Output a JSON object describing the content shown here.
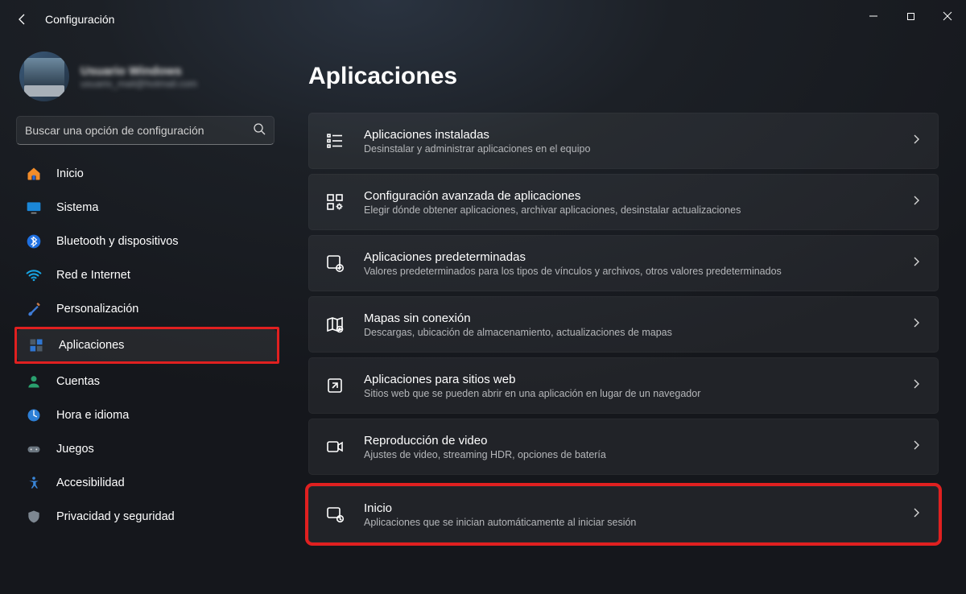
{
  "titlebar": {
    "title": "Configuración"
  },
  "user": {
    "name": "Usuario Windows",
    "email": "usuario_mail@hotmail.com"
  },
  "search": {
    "placeholder": "Buscar una opción de configuración"
  },
  "sidebar": {
    "items": [
      {
        "label": "Inicio"
      },
      {
        "label": "Sistema"
      },
      {
        "label": "Bluetooth y dispositivos"
      },
      {
        "label": "Red e Internet"
      },
      {
        "label": "Personalización"
      },
      {
        "label": "Aplicaciones"
      },
      {
        "label": "Cuentas"
      },
      {
        "label": "Hora e idioma"
      },
      {
        "label": "Juegos"
      },
      {
        "label": "Accesibilidad"
      },
      {
        "label": "Privacidad y seguridad"
      }
    ]
  },
  "page": {
    "heading": "Aplicaciones"
  },
  "cards": [
    {
      "title": "Aplicaciones instaladas",
      "subtitle": "Desinstalar y administrar aplicaciones en el equipo"
    },
    {
      "title": "Configuración avanzada de aplicaciones",
      "subtitle": "Elegir dónde obtener aplicaciones, archivar aplicaciones, desinstalar actualizaciones"
    },
    {
      "title": "Aplicaciones predeterminadas",
      "subtitle": "Valores predeterminados para los tipos de vínculos y archivos, otros valores predeterminados"
    },
    {
      "title": "Mapas sin conexión",
      "subtitle": "Descargas, ubicación de almacenamiento, actualizaciones de mapas"
    },
    {
      "title": "Aplicaciones para sitios web",
      "subtitle": "Sitios web que se pueden abrir en una aplicación en lugar de un navegador"
    },
    {
      "title": "Reproducción de video",
      "subtitle": "Ajustes de video, streaming HDR, opciones de batería"
    },
    {
      "title": "Inicio",
      "subtitle": "Aplicaciones que se inician automáticamente al iniciar sesión"
    }
  ]
}
